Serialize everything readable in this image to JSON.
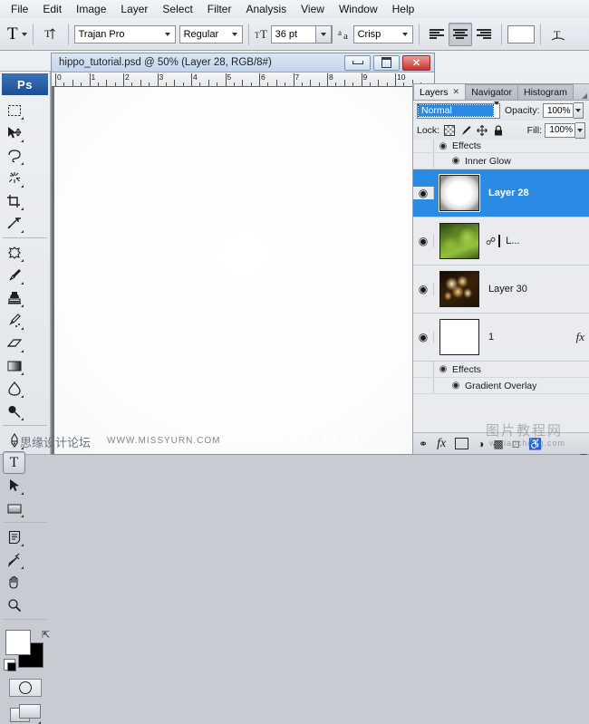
{
  "app": {
    "name": "Adobe Photoshop",
    "logo_text": "Ps"
  },
  "menubar": {
    "items": [
      {
        "label": "File"
      },
      {
        "label": "Edit"
      },
      {
        "label": "Image"
      },
      {
        "label": "Layer"
      },
      {
        "label": "Select"
      },
      {
        "label": "Filter"
      },
      {
        "label": "Analysis"
      },
      {
        "label": "View"
      },
      {
        "label": "Window"
      },
      {
        "label": "Help"
      }
    ]
  },
  "options_bar": {
    "tool_glyph": "T",
    "tool_preset_name": "type-tool-preset",
    "orientation_icon": "text-orientation-icon",
    "font_family": "Trajan Pro",
    "font_style": "Regular",
    "size_icon": "font-size-icon",
    "font_size": "36 pt",
    "antialias_icon": "anti-alias-icon",
    "antialias": "Crisp",
    "align_left": "align-left",
    "align_center": "align-center",
    "align_right": "align-right",
    "align_selected": "align-center",
    "color_swatch": "#ffffff",
    "warp_icon": "warp-text-icon"
  },
  "toolbox": {
    "tools": [
      {
        "name": "rectangular-marquee-tool",
        "glyph": "⬚",
        "has_flyout": true,
        "selected": false
      },
      {
        "name": "move-tool",
        "glyph": "➤",
        "has_flyout": true,
        "selected": false
      },
      {
        "name": "lasso-tool",
        "glyph": "☁",
        "has_flyout": true,
        "selected": false
      },
      {
        "name": "magic-wand-tool",
        "glyph": "✳",
        "has_flyout": true,
        "selected": false
      },
      {
        "name": "crop-tool",
        "glyph": "⌗",
        "has_flyout": true,
        "selected": false
      },
      {
        "name": "slice-tool",
        "glyph": "✂",
        "has_flyout": true,
        "selected": false
      },
      {
        "name": "healing-brush-tool",
        "glyph": "❁",
        "has_flyout": true,
        "selected": false
      },
      {
        "name": "brush-tool",
        "glyph": "✒",
        "has_flyout": true,
        "selected": false
      },
      {
        "name": "clone-stamp-tool",
        "glyph": "♟",
        "has_flyout": true,
        "selected": false
      },
      {
        "name": "history-brush-tool",
        "glyph": "✎",
        "has_flyout": true,
        "selected": false
      },
      {
        "name": "eraser-tool",
        "glyph": "▱",
        "has_flyout": true,
        "selected": false
      },
      {
        "name": "gradient-tool",
        "glyph": "▨",
        "has_flyout": true,
        "selected": false
      },
      {
        "name": "blur-tool",
        "glyph": "●",
        "has_flyout": true,
        "selected": false
      },
      {
        "name": "dodge-tool",
        "glyph": "⚲",
        "has_flyout": true,
        "selected": false
      },
      {
        "name": "pen-tool",
        "glyph": "✑",
        "has_flyout": true,
        "selected": false
      },
      {
        "name": "type-tool",
        "glyph": "T",
        "has_flyout": false,
        "selected": true
      },
      {
        "name": "path-selection-tool",
        "glyph": "➤",
        "has_flyout": true,
        "selected": false
      },
      {
        "name": "rectangle-shape-tool",
        "glyph": "▬",
        "has_flyout": true,
        "selected": false
      },
      {
        "name": "notes-tool",
        "glyph": "☰",
        "has_flyout": true,
        "selected": false
      },
      {
        "name": "eyedropper-tool",
        "glyph": "✐",
        "has_flyout": true,
        "selected": false
      },
      {
        "name": "hand-tool",
        "glyph": "✋",
        "has_flyout": false,
        "selected": false
      },
      {
        "name": "zoom-tool",
        "glyph": "⌕",
        "has_flyout": false,
        "selected": false
      }
    ],
    "foreground_color": "#ffffff",
    "background_color": "#000000",
    "swap_icon": "swap-colors-icon",
    "default_colors_icon": "default-colors-icon",
    "quick_mask_icon": "quick-mask-icon",
    "screen_mode_icon": "screen-mode-icon"
  },
  "document": {
    "title": "hippo_tutorial.psd @ 50% (Layer 28, RGB/8#)",
    "file_name": "hippo_tutorial.psd",
    "zoom": "50%",
    "active_layer": "Layer 28",
    "color_mode": "RGB/8#",
    "window_buttons": {
      "minimize": "minimize-button",
      "restore": "restore-button",
      "close_label": "✕"
    },
    "ruler": {
      "unit": "inches",
      "labels": [
        "0",
        "1",
        "2",
        "3",
        "4",
        "5",
        "6",
        "7",
        "8",
        "9",
        "10"
      ]
    }
  },
  "panel": {
    "tabs": [
      {
        "label": "Layers",
        "active": true,
        "closable": true
      },
      {
        "label": "Navigator",
        "active": false,
        "closable": false
      },
      {
        "label": "Histogram",
        "active": false,
        "closable": false
      }
    ],
    "blend_mode": "Normal",
    "opacity_label": "Opacity:",
    "opacity_value": "100%",
    "lock_label": "Lock:",
    "lock_icons": [
      "lock-transparent-pixels-icon",
      "lock-image-pixels-icon",
      "lock-position-icon",
      "lock-all-icon"
    ],
    "fill_label": "Fill:",
    "fill_value": "100%",
    "selection_color": "#2a8ae4",
    "rows": [
      {
        "kind": "effect-group",
        "label": "Effects",
        "indent": 1,
        "eye": "◉"
      },
      {
        "kind": "effect-item",
        "label": "Inner Glow",
        "indent": 2,
        "eye": "◉"
      },
      {
        "kind": "layer",
        "name": "Layer 28",
        "thumb": "glow",
        "selected": true,
        "eye": "◉",
        "has_mask": false,
        "has_fx": false
      },
      {
        "kind": "layer",
        "name": "L...",
        "thumb": "moss",
        "selected": false,
        "eye": "◉",
        "has_mask": true,
        "mask_thumb": "mask-grad",
        "link_icon": "link-mask-icon",
        "has_fx": false
      },
      {
        "kind": "layer",
        "name": "Layer 30",
        "thumb": "bokeh",
        "selected": false,
        "eye": "◉",
        "has_mask": false,
        "has_fx": false
      },
      {
        "kind": "layer",
        "name": "1",
        "thumb": "white",
        "selected": false,
        "eye": "◉",
        "has_mask": false,
        "has_fx": true,
        "fx_label": "fx"
      },
      {
        "kind": "effect-group",
        "label": "Effects",
        "indent": 1,
        "eye": "◉"
      },
      {
        "kind": "effect-item",
        "label": "Gradient Overlay",
        "indent": 2,
        "eye": "◉"
      }
    ],
    "footer_icons": [
      {
        "name": "link-layers-icon",
        "glyph": "⚭"
      },
      {
        "name": "add-layer-style-icon",
        "glyph": "fx"
      },
      {
        "name": "add-layer-mask-icon",
        "glyph": "▣"
      },
      {
        "name": "new-adjustment-layer-icon",
        "glyph": "◑"
      },
      {
        "name": "new-group-icon",
        "glyph": "▱"
      },
      {
        "name": "new-layer-icon",
        "glyph": "□"
      },
      {
        "name": "delete-layer-icon",
        "glyph": "⌧"
      }
    ],
    "scrollbar": "layers-scrollbar"
  },
  "watermarks": {
    "big": "A.I.F.O.A.R.F.C.O.M",
    "forum_cn": "思缘设计论坛",
    "url": "WWW.MISSYURN.COM",
    "panel_cn": "图片教程网",
    "panel_url": "wzjiaocheng.com"
  }
}
